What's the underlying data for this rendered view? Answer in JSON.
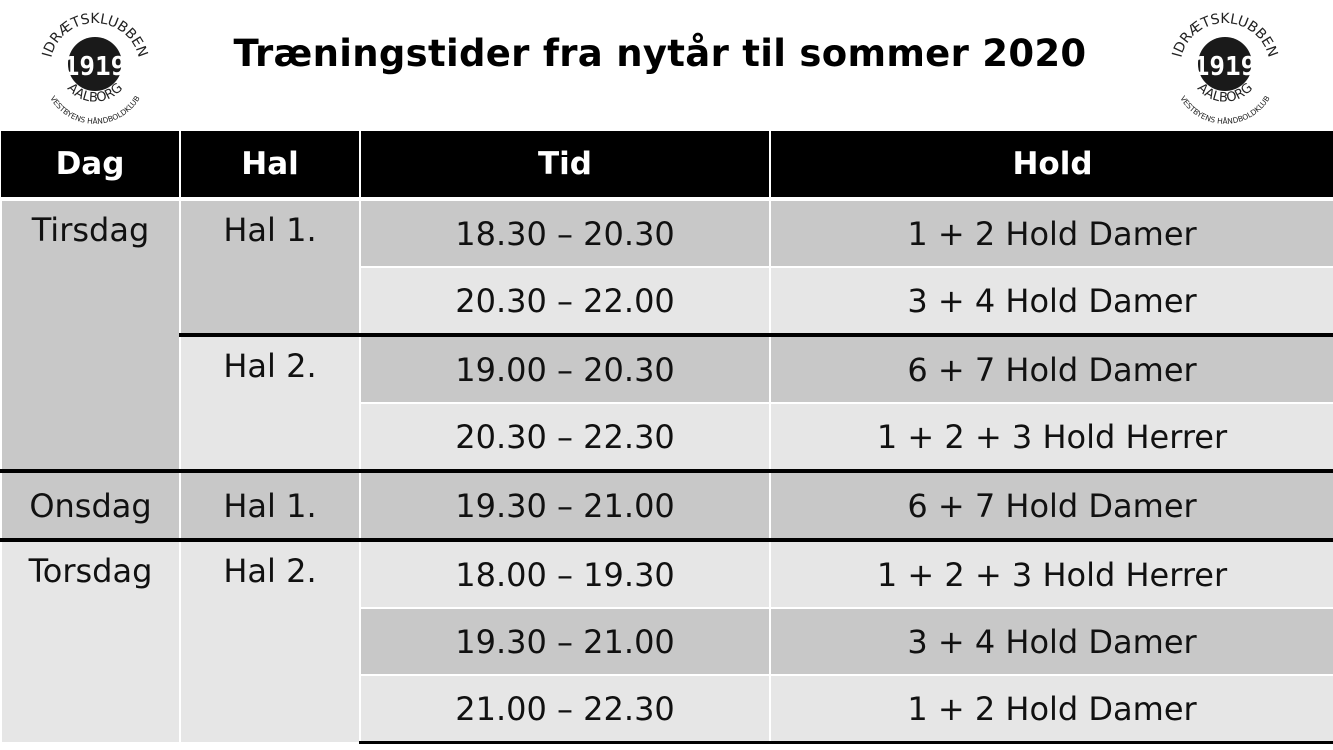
{
  "title": "Træningstider fra nytår til sommer 2020",
  "logo": {
    "top_text": "IDRÆTSKLUBBEN",
    "number": "1919",
    "bottom_text": "AALBORG",
    "sub_text": "VESTBYENS HÅNDBOLDKLUB"
  },
  "table": {
    "headers": [
      "Dag",
      "Hal",
      "Tid",
      "Hold"
    ],
    "rows": [
      {
        "day": "Tirsdag",
        "hall": "Hal 1.",
        "time": "18.30 – 20.30",
        "team": "1 + 2 Hold Damer"
      },
      {
        "day": "",
        "hall": "",
        "time": "20.30 – 22.00",
        "team": "3 + 4 Hold Damer"
      },
      {
        "day": "",
        "hall": "Hal 2.",
        "time": "19.00 – 20.30",
        "team": "6 + 7 Hold Damer"
      },
      {
        "day": "",
        "hall": "",
        "time": "20.30 – 22.30",
        "team": "1 + 2 + 3 Hold Herrer"
      },
      {
        "day": "Onsdag",
        "hall": "Hal 1.",
        "time": "19.30 – 21.00",
        "team": "6 + 7 Hold Damer"
      },
      {
        "day": "Torsdag",
        "hall": "Hal 2.",
        "time": "18.00 – 19.30",
        "team": "1 + 2 + 3 Hold Herrer"
      },
      {
        "day": "",
        "hall": "",
        "time": "19.30 – 21.00",
        "team": "3 + 4 Hold Damer"
      },
      {
        "day": "",
        "hall": "",
        "time": "21.00 – 22.30",
        "team": "1 + 2 Hold Damer"
      }
    ]
  }
}
